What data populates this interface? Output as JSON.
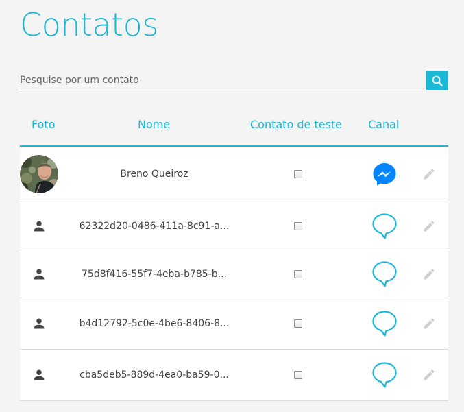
{
  "title": "Contatos",
  "search": {
    "placeholder": "Pesquise por um contato",
    "value": "",
    "button_icon": "search-icon"
  },
  "columns": {
    "photo": "Foto",
    "name": "Nome",
    "test": "Contato de teste",
    "channel": "Canal"
  },
  "colors": {
    "accent": "#1ab8d4",
    "messenger": "#0084ff",
    "edit_icon": "#cfcfcf",
    "person_icon": "#444444"
  },
  "contacts": [
    {
      "name": "Breno Queiroz",
      "photo": "avatar-photo",
      "test_contact": false,
      "channel": "messenger-icon",
      "edit_icon": "pencil-icon"
    },
    {
      "name": "62322d20-0486-411a-8c91-a...",
      "photo": "person-icon",
      "test_contact": false,
      "channel": "chat-bubble-icon",
      "edit_icon": "pencil-icon"
    },
    {
      "name": "75d8f416-55f7-4eba-b785-b...",
      "photo": "person-icon",
      "test_contact": false,
      "channel": "chat-bubble-icon",
      "edit_icon": "pencil-icon"
    },
    {
      "name": "b4d12792-5c0e-4be6-8406-8...",
      "photo": "person-icon",
      "test_contact": false,
      "channel": "chat-bubble-icon",
      "edit_icon": "pencil-icon"
    },
    {
      "name": "cba5deb5-889d-4ea0-ba59-0...",
      "photo": "person-icon",
      "test_contact": false,
      "channel": "chat-bubble-icon",
      "edit_icon": "pencil-icon"
    }
  ]
}
